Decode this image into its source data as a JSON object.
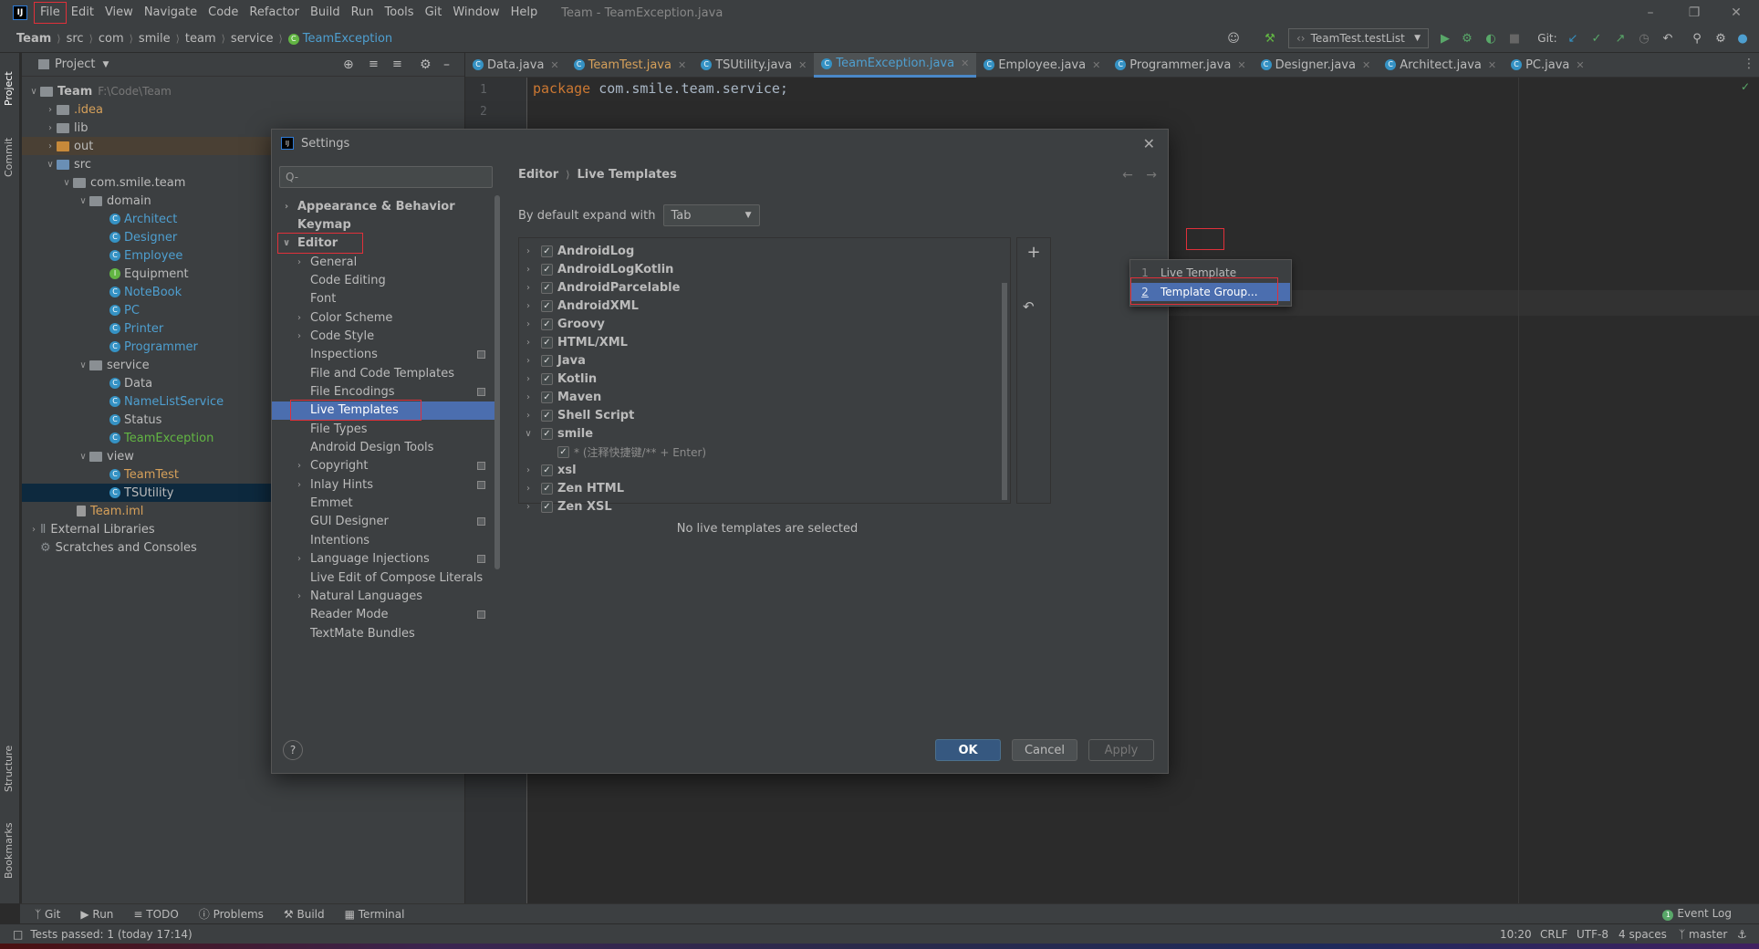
{
  "menubar": {
    "items": [
      "File",
      "Edit",
      "View",
      "Navigate",
      "Code",
      "Refactor",
      "Build",
      "Run",
      "Tools",
      "Git",
      "Window",
      "Help"
    ],
    "window_title": "Team - TeamException.java"
  },
  "navbar": {
    "crumbs": [
      "Team",
      "src",
      "com",
      "smile",
      "team",
      "service"
    ],
    "current": "TeamException",
    "run_config": "TeamTest.testList",
    "git_label": "Git:"
  },
  "project": {
    "header": "Project",
    "tree": [
      {
        "label": "Team",
        "extra": "F:\\Code\\Team",
        "indent": 0,
        "chev": "v",
        "icon": "folder",
        "bold": true
      },
      {
        "label": ".idea",
        "indent": 1,
        "chev": ">",
        "icon": "folder",
        "color": "#d6a05a"
      },
      {
        "label": "lib",
        "indent": 1,
        "chev": ">",
        "icon": "folder"
      },
      {
        "label": "out",
        "indent": 1,
        "chev": ">",
        "icon": "folder-orange",
        "highlight": true
      },
      {
        "label": "src",
        "indent": 1,
        "chev": "v",
        "icon": "folder-blue"
      },
      {
        "label": "com.smile.team",
        "indent": 2,
        "chev": "v",
        "icon": "package"
      },
      {
        "label": "domain",
        "indent": 3,
        "chev": "v",
        "icon": "package"
      },
      {
        "label": "Architect",
        "indent": 4,
        "icon": "class",
        "color": "#4e9fd0"
      },
      {
        "label": "Designer",
        "indent": 4,
        "icon": "class",
        "color": "#4e9fd0"
      },
      {
        "label": "Employee",
        "indent": 4,
        "icon": "class",
        "color": "#4e9fd0"
      },
      {
        "label": "Equipment",
        "indent": 4,
        "icon": "interface"
      },
      {
        "label": "NoteBook",
        "indent": 4,
        "icon": "class",
        "color": "#4e9fd0"
      },
      {
        "label": "PC",
        "indent": 4,
        "icon": "class",
        "color": "#4e9fd0"
      },
      {
        "label": "Printer",
        "indent": 4,
        "icon": "class",
        "color": "#4e9fd0"
      },
      {
        "label": "Programmer",
        "indent": 4,
        "icon": "class",
        "color": "#4e9fd0"
      },
      {
        "label": "service",
        "indent": 3,
        "chev": "v",
        "icon": "package"
      },
      {
        "label": "Data",
        "indent": 4,
        "icon": "class"
      },
      {
        "label": "NameListService",
        "indent": 4,
        "icon": "class",
        "color": "#4e9fd0"
      },
      {
        "label": "Status",
        "indent": 4,
        "icon": "class"
      },
      {
        "label": "TeamException",
        "indent": 4,
        "icon": "class",
        "color": "#62b543"
      },
      {
        "label": "view",
        "indent": 3,
        "chev": "v",
        "icon": "package"
      },
      {
        "label": "TeamTest",
        "indent": 4,
        "icon": "class",
        "color": "#d6a05a"
      },
      {
        "label": "TSUtility",
        "indent": 4,
        "icon": "class",
        "color": "#bbbbbb",
        "selected": true
      },
      {
        "label": "Team.iml",
        "indent": 2,
        "icon": "file",
        "color": "#d6a05a"
      },
      {
        "label": "External Libraries",
        "indent": 0,
        "chev": ">",
        "icon": "libs"
      },
      {
        "label": "Scratches and Consoles",
        "indent": 0,
        "icon": "scratch"
      }
    ]
  },
  "tabs": [
    {
      "label": "Data.java"
    },
    {
      "label": "TeamTest.java",
      "orange": true
    },
    {
      "label": "TSUtility.java"
    },
    {
      "label": "TeamException.java",
      "active": true
    },
    {
      "label": "Employee.java"
    },
    {
      "label": "Programmer.java"
    },
    {
      "label": "Designer.java"
    },
    {
      "label": "Architect.java"
    },
    {
      "label": "PC.java"
    }
  ],
  "editor": {
    "line_numbers": [
      "1",
      "2"
    ],
    "code_keyword": "package",
    "code_rest": " com.smile.team.service;"
  },
  "left_strip": {
    "project": "Project",
    "commit": "Commit",
    "structure": "Structure",
    "bookmarks": "Bookmarks"
  },
  "toolwindows": [
    "Git",
    "Run",
    "TODO",
    "Problems",
    "Build",
    "Terminal"
  ],
  "event_log": "Event Log",
  "status": {
    "message": "Tests passed: 1 (today 17:14)",
    "position": "10:20",
    "line_sep": "CRLF",
    "encoding": "UTF-8",
    "indent": "4 spaces",
    "branch": "master"
  },
  "settings": {
    "title": "Settings",
    "search_placeholder": "Q-",
    "tree": [
      {
        "label": "Appearance & Behavior",
        "level": 0,
        "chev": ">",
        "bold": true
      },
      {
        "label": "Keymap",
        "level": 0,
        "bold": true
      },
      {
        "label": "Editor",
        "level": 0,
        "chev": "v",
        "bold": true,
        "boxed": true
      },
      {
        "label": "General",
        "level": 1,
        "chev": ">"
      },
      {
        "label": "Code Editing",
        "level": 1
      },
      {
        "label": "Font",
        "level": 1
      },
      {
        "label": "Color Scheme",
        "level": 1,
        "chev": ">"
      },
      {
        "label": "Code Style",
        "level": 1,
        "chev": ">"
      },
      {
        "label": "Inspections",
        "level": 1,
        "proj": true
      },
      {
        "label": "File and Code Templates",
        "level": 1
      },
      {
        "label": "File Encodings",
        "level": 1,
        "proj": true
      },
      {
        "label": "Live Templates",
        "level": 1,
        "selected": true,
        "boxed": true
      },
      {
        "label": "File Types",
        "level": 1
      },
      {
        "label": "Android Design Tools",
        "level": 1
      },
      {
        "label": "Copyright",
        "level": 1,
        "chev": ">",
        "proj": true
      },
      {
        "label": "Inlay Hints",
        "level": 1,
        "chev": ">",
        "proj": true
      },
      {
        "label": "Emmet",
        "level": 1
      },
      {
        "label": "GUI Designer",
        "level": 1,
        "proj": true
      },
      {
        "label": "Intentions",
        "level": 1
      },
      {
        "label": "Language Injections",
        "level": 1,
        "chev": ">",
        "proj": true
      },
      {
        "label": "Live Edit of Compose Literals",
        "level": 1
      },
      {
        "label": "Natural Languages",
        "level": 1,
        "chev": ">"
      },
      {
        "label": "Reader Mode",
        "level": 1,
        "proj": true
      },
      {
        "label": "TextMate Bundles",
        "level": 1
      }
    ],
    "breadcrumb": [
      "Editor",
      "Live Templates"
    ],
    "expand_label": "By default expand with",
    "expand_value": "Tab",
    "templates": [
      {
        "label": "AndroidLog",
        "chev": ">"
      },
      {
        "label": "AndroidLogKotlin",
        "chev": ">"
      },
      {
        "label": "AndroidParcelable",
        "chev": ">"
      },
      {
        "label": "AndroidXML",
        "chev": ">"
      },
      {
        "label": "Groovy",
        "chev": ">"
      },
      {
        "label": "HTML/XML",
        "chev": ">"
      },
      {
        "label": "Java",
        "chev": ">"
      },
      {
        "label": "Kotlin",
        "chev": ">"
      },
      {
        "label": "Maven",
        "chev": ">"
      },
      {
        "label": "Shell Script",
        "chev": ">"
      },
      {
        "label": "smile",
        "chev": "v"
      },
      {
        "label": "* (注释快捷键/** + Enter)",
        "sub": true
      },
      {
        "label": "xsl",
        "chev": ">"
      },
      {
        "label": "Zen HTML",
        "chev": ">"
      },
      {
        "label": "Zen XSL",
        "chev": ">"
      }
    ],
    "no_selection": "No live templates are selected",
    "popup": [
      {
        "num": "1",
        "label": "Live Template"
      },
      {
        "num": "2",
        "label": "Template Group...",
        "selected": true
      }
    ],
    "buttons": {
      "ok": "OK",
      "cancel": "Cancel",
      "apply": "Apply",
      "help": "?"
    }
  }
}
